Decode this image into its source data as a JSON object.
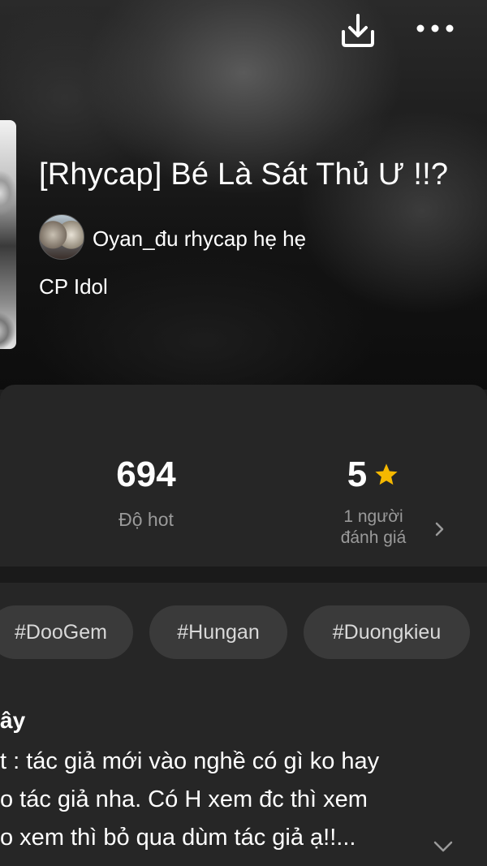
{
  "toolbar": {
    "download_icon": "download-icon",
    "more_icon": "more-options-icon"
  },
  "story": {
    "title": "[Rhycap] Bé Là Sát Thủ Ư !!?",
    "author": "Oyan_đu rhycap hẹ hẹ",
    "category": "CP Idol"
  },
  "stats": {
    "hot_value": "694",
    "hot_label": "Độ hot",
    "rating_value": "5",
    "rating_label_line1": "1 người",
    "rating_label_line2": "đánh giá"
  },
  "tags": [
    "#DooGem",
    "#Hungan",
    "#Duongkieu"
  ],
  "description": {
    "heading": "ây",
    "line1": "t : tác giả mới vào nghề có gì ko hay",
    "line2": "o tác giả nha. Có H xem đc thì xem",
    "line3": "o xem thì bỏ qua dùm tác giả ạ!!..."
  },
  "colors": {
    "star": "#F5B800",
    "panel": "#262626",
    "tag_bg": "#3a3a3a"
  }
}
